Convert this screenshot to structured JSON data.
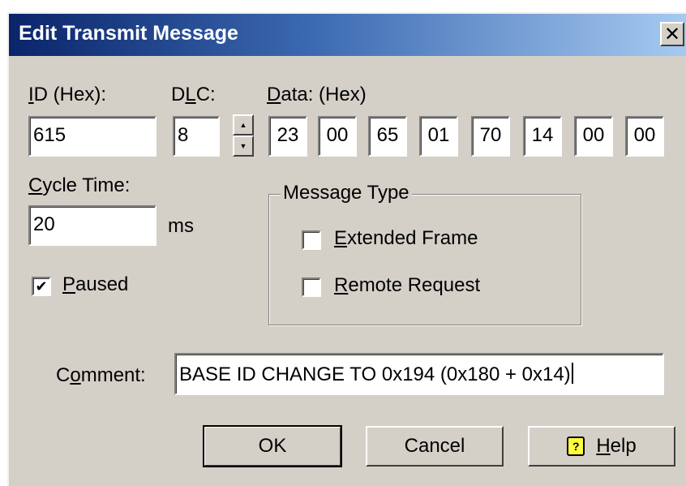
{
  "window": {
    "title": "Edit Transmit Message",
    "close_glyph": "✕"
  },
  "id_field": {
    "label_accel": "I",
    "label_rest": "D (Hex):",
    "value": "615"
  },
  "dlc_field": {
    "label_pre": "D",
    "label_accel": "L",
    "label_post": "C:",
    "value": "8",
    "spin_up": "▲",
    "spin_down": "▼"
  },
  "data_field": {
    "label_accel": "D",
    "label_rest": "ata: (Hex)",
    "bytes": [
      "23",
      "00",
      "65",
      "01",
      "70",
      "14",
      "00",
      "00"
    ]
  },
  "cycle_time": {
    "label_accel": "C",
    "label_rest": "ycle Time:",
    "value": "20",
    "unit": "ms"
  },
  "paused": {
    "label_accel": "P",
    "label_rest": "aused",
    "checked": true,
    "mark": "✔"
  },
  "message_type": {
    "legend": "Message Type",
    "extended_frame": {
      "label_accel": "E",
      "label_rest": "xtended Frame",
      "checked": false
    },
    "remote_request": {
      "label_accel": "R",
      "label_rest": "emote Request",
      "checked": false
    }
  },
  "comment": {
    "label_pre": "C",
    "label_accel": "o",
    "label_post": "mment:",
    "value": "BASE ID CHANGE TO 0x194 (0x180 + 0x14)"
  },
  "buttons": {
    "ok": "OK",
    "cancel": "Cancel",
    "help_accel": "H",
    "help_rest": "elp",
    "help_icon_glyph": "?"
  }
}
